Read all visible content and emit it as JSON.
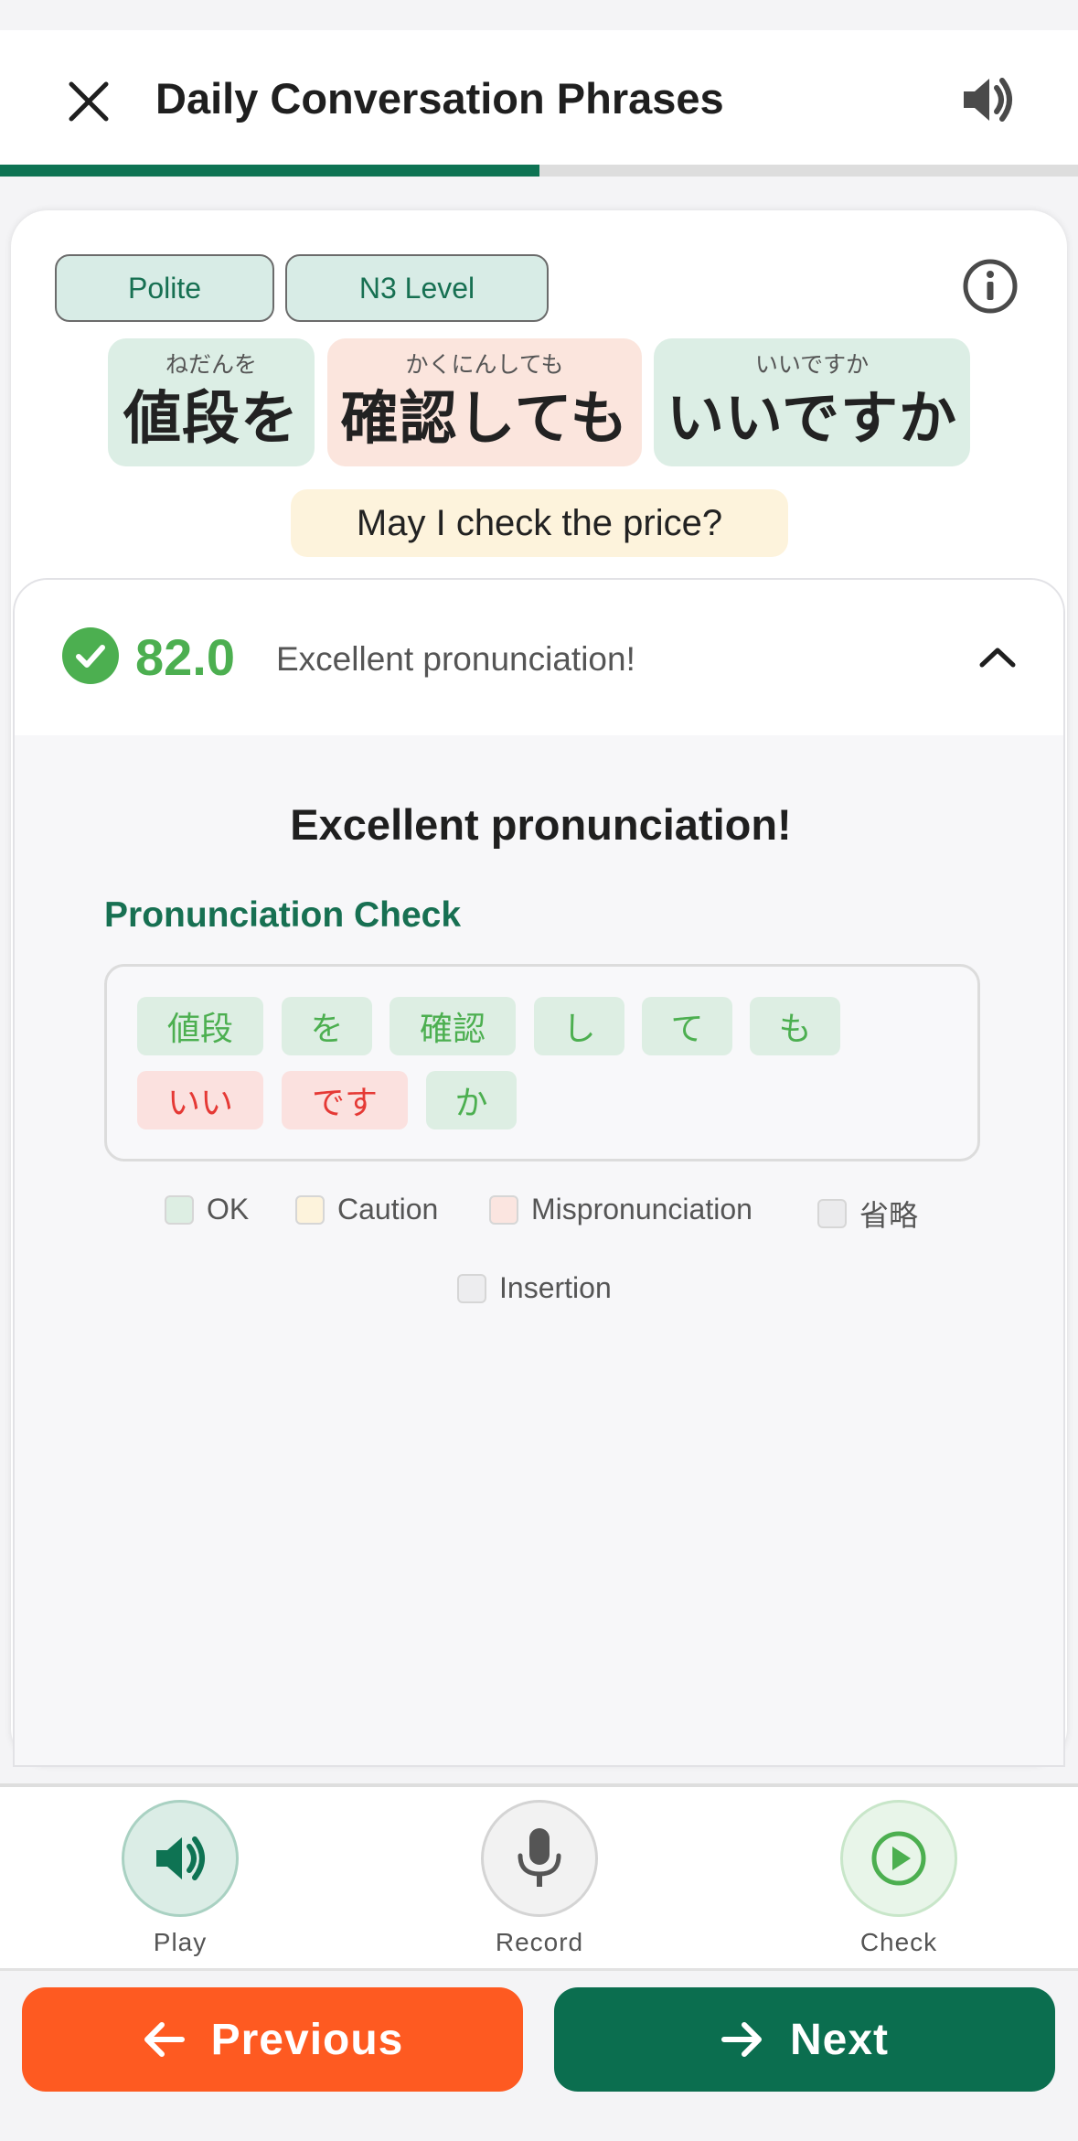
{
  "header": {
    "title": "Daily Conversation Phrases",
    "close_icon": "close-icon",
    "speaker_icon": "speaker-icon",
    "progress_percent": 50
  },
  "tags": [
    "Polite",
    "N3 Level"
  ],
  "phrase": {
    "words": [
      {
        "furigana": "ねだんを",
        "text": "値段を",
        "status": "ok"
      },
      {
        "furigana": "かくにんしても",
        "text": "確認しても",
        "status": "caution"
      },
      {
        "furigana": "いいですか",
        "text": "いいですか",
        "status": "ok"
      }
    ],
    "translation": "May I check the price?"
  },
  "result": {
    "score": "82.0",
    "summary": "Excellent pronunciation!",
    "heading": "Excellent pronunciation!",
    "section_title": "Pronunciation Check",
    "chips": [
      {
        "text": "値段",
        "status": "ok"
      },
      {
        "text": "を",
        "status": "ok"
      },
      {
        "text": "確認",
        "status": "ok"
      },
      {
        "text": "し",
        "status": "ok"
      },
      {
        "text": "て",
        "status": "ok"
      },
      {
        "text": "も",
        "status": "ok"
      },
      {
        "text": "いい",
        "status": "mispronunciation"
      },
      {
        "text": "です",
        "status": "mispronunciation"
      },
      {
        "text": "か",
        "status": "ok"
      }
    ],
    "legend": [
      "OK",
      "Caution",
      "Mispronunciation",
      "省略",
      "Insertion"
    ]
  },
  "actions": {
    "play": "Play",
    "record": "Record",
    "check": "Check"
  },
  "nav": {
    "previous": "Previous",
    "next": "Next"
  },
  "colors": {
    "accent": "#0e7353",
    "ok": "#4caf50",
    "error": "#e53935",
    "previous": "#fe5a21",
    "next": "#0b6e4f"
  }
}
